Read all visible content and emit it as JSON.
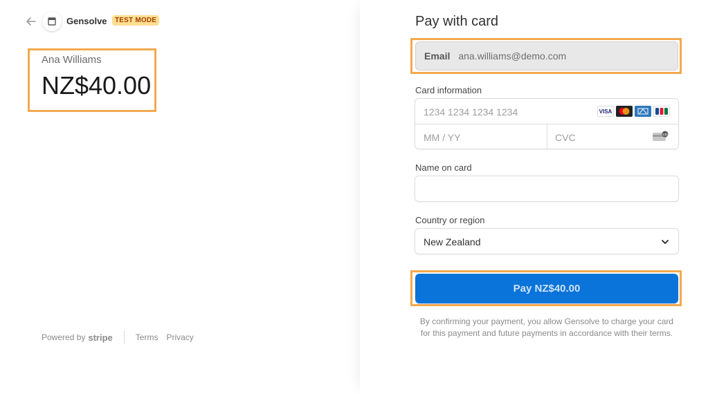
{
  "merchant": {
    "name": "Gensolve",
    "test_badge": "TEST MODE"
  },
  "summary": {
    "customer_name": "Ana Williams",
    "amount": "NZ$40.00"
  },
  "footer": {
    "powered_by": "Powered by",
    "stripe": "stripe",
    "terms": "Terms",
    "privacy": "Privacy"
  },
  "form": {
    "title": "Pay with card",
    "email_label": "Email",
    "email_value": "ana.williams@demo.com",
    "card_info_label": "Card information",
    "card_number_placeholder": "1234 1234 1234 1234",
    "expiry_placeholder": "MM / YY",
    "cvc_placeholder": "CVC",
    "name_label": "Name on card",
    "name_value": "",
    "country_label": "Country or region",
    "country_value": "New Zealand",
    "pay_button": "Pay NZ$40.00",
    "terms_text": "By confirming your payment, you allow Gensolve to charge your card for this payment and future payments in accordance with their terms."
  },
  "card_brands": [
    "VISA",
    "mastercard",
    "amex",
    "JCB"
  ],
  "colors": {
    "accent": "#0a74da",
    "highlight": "#f4a94e",
    "test_badge_bg": "#ffde92"
  }
}
